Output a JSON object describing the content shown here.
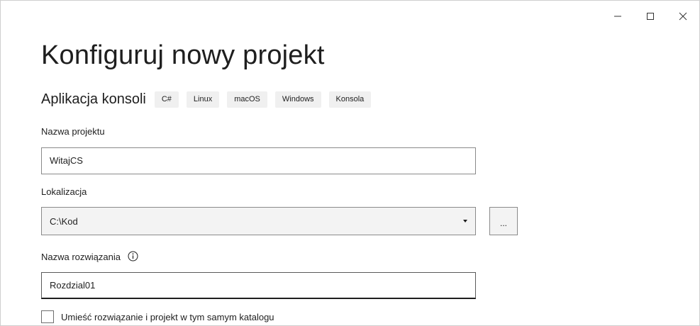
{
  "window": {
    "controls": {
      "minimize_icon": "minimize-icon",
      "maximize_icon": "maximize-icon",
      "close_icon": "close-icon"
    }
  },
  "page": {
    "heading": "Konfiguruj nowy projekt",
    "template_name": "Aplikacja konsoli",
    "tags": [
      "C#",
      "Linux",
      "macOS",
      "Windows",
      "Konsola"
    ]
  },
  "form": {
    "project_name": {
      "label": "Nazwa projektu",
      "value": "WitajCS"
    },
    "location": {
      "label": "Lokalizacja",
      "value": "C:\\Kod",
      "browse_label": "..."
    },
    "solution_name": {
      "label": "Nazwa rozwiązania",
      "value": "Rozdzial01",
      "info_icon": "info-icon"
    },
    "same_directory": {
      "label": "Umieść rozwiązanie i projekt w tym samym katalogu",
      "checked": false
    }
  },
  "colors": {
    "tag_background": "#f0f0f0",
    "input_border": "#8a8a8a",
    "focused_border": "#1e1e1e"
  }
}
